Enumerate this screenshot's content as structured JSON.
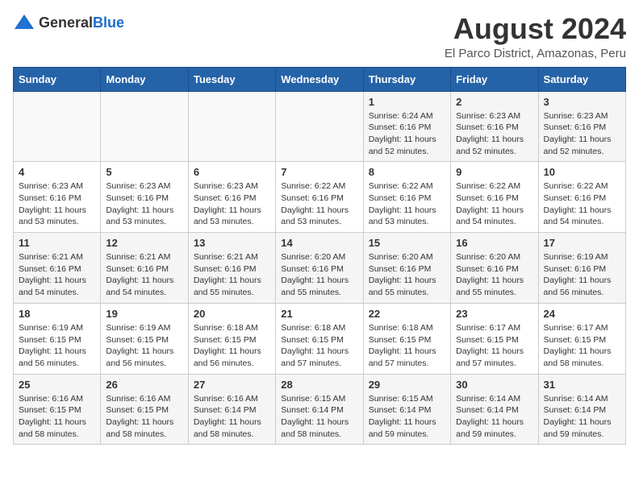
{
  "logo": {
    "general": "General",
    "blue": "Blue"
  },
  "title": "August 2024",
  "subtitle": "El Parco District, Amazonas, Peru",
  "days_of_week": [
    "Sunday",
    "Monday",
    "Tuesday",
    "Wednesday",
    "Thursday",
    "Friday",
    "Saturday"
  ],
  "weeks": [
    [
      {
        "day": "",
        "info": ""
      },
      {
        "day": "",
        "info": ""
      },
      {
        "day": "",
        "info": ""
      },
      {
        "day": "",
        "info": ""
      },
      {
        "day": "1",
        "info": "Sunrise: 6:24 AM\nSunset: 6:16 PM\nDaylight: 11 hours and 52 minutes."
      },
      {
        "day": "2",
        "info": "Sunrise: 6:23 AM\nSunset: 6:16 PM\nDaylight: 11 hours and 52 minutes."
      },
      {
        "day": "3",
        "info": "Sunrise: 6:23 AM\nSunset: 6:16 PM\nDaylight: 11 hours and 52 minutes."
      }
    ],
    [
      {
        "day": "4",
        "info": "Sunrise: 6:23 AM\nSunset: 6:16 PM\nDaylight: 11 hours and 53 minutes."
      },
      {
        "day": "5",
        "info": "Sunrise: 6:23 AM\nSunset: 6:16 PM\nDaylight: 11 hours and 53 minutes."
      },
      {
        "day": "6",
        "info": "Sunrise: 6:23 AM\nSunset: 6:16 PM\nDaylight: 11 hours and 53 minutes."
      },
      {
        "day": "7",
        "info": "Sunrise: 6:22 AM\nSunset: 6:16 PM\nDaylight: 11 hours and 53 minutes."
      },
      {
        "day": "8",
        "info": "Sunrise: 6:22 AM\nSunset: 6:16 PM\nDaylight: 11 hours and 53 minutes."
      },
      {
        "day": "9",
        "info": "Sunrise: 6:22 AM\nSunset: 6:16 PM\nDaylight: 11 hours and 54 minutes."
      },
      {
        "day": "10",
        "info": "Sunrise: 6:22 AM\nSunset: 6:16 PM\nDaylight: 11 hours and 54 minutes."
      }
    ],
    [
      {
        "day": "11",
        "info": "Sunrise: 6:21 AM\nSunset: 6:16 PM\nDaylight: 11 hours and 54 minutes."
      },
      {
        "day": "12",
        "info": "Sunrise: 6:21 AM\nSunset: 6:16 PM\nDaylight: 11 hours and 54 minutes."
      },
      {
        "day": "13",
        "info": "Sunrise: 6:21 AM\nSunset: 6:16 PM\nDaylight: 11 hours and 55 minutes."
      },
      {
        "day": "14",
        "info": "Sunrise: 6:20 AM\nSunset: 6:16 PM\nDaylight: 11 hours and 55 minutes."
      },
      {
        "day": "15",
        "info": "Sunrise: 6:20 AM\nSunset: 6:16 PM\nDaylight: 11 hours and 55 minutes."
      },
      {
        "day": "16",
        "info": "Sunrise: 6:20 AM\nSunset: 6:16 PM\nDaylight: 11 hours and 55 minutes."
      },
      {
        "day": "17",
        "info": "Sunrise: 6:19 AM\nSunset: 6:16 PM\nDaylight: 11 hours and 56 minutes."
      }
    ],
    [
      {
        "day": "18",
        "info": "Sunrise: 6:19 AM\nSunset: 6:15 PM\nDaylight: 11 hours and 56 minutes."
      },
      {
        "day": "19",
        "info": "Sunrise: 6:19 AM\nSunset: 6:15 PM\nDaylight: 11 hours and 56 minutes."
      },
      {
        "day": "20",
        "info": "Sunrise: 6:18 AM\nSunset: 6:15 PM\nDaylight: 11 hours and 56 minutes."
      },
      {
        "day": "21",
        "info": "Sunrise: 6:18 AM\nSunset: 6:15 PM\nDaylight: 11 hours and 57 minutes."
      },
      {
        "day": "22",
        "info": "Sunrise: 6:18 AM\nSunset: 6:15 PM\nDaylight: 11 hours and 57 minutes."
      },
      {
        "day": "23",
        "info": "Sunrise: 6:17 AM\nSunset: 6:15 PM\nDaylight: 11 hours and 57 minutes."
      },
      {
        "day": "24",
        "info": "Sunrise: 6:17 AM\nSunset: 6:15 PM\nDaylight: 11 hours and 58 minutes."
      }
    ],
    [
      {
        "day": "25",
        "info": "Sunrise: 6:16 AM\nSunset: 6:15 PM\nDaylight: 11 hours and 58 minutes."
      },
      {
        "day": "26",
        "info": "Sunrise: 6:16 AM\nSunset: 6:15 PM\nDaylight: 11 hours and 58 minutes."
      },
      {
        "day": "27",
        "info": "Sunrise: 6:16 AM\nSunset: 6:14 PM\nDaylight: 11 hours and 58 minutes."
      },
      {
        "day": "28",
        "info": "Sunrise: 6:15 AM\nSunset: 6:14 PM\nDaylight: 11 hours and 58 minutes."
      },
      {
        "day": "29",
        "info": "Sunrise: 6:15 AM\nSunset: 6:14 PM\nDaylight: 11 hours and 59 minutes."
      },
      {
        "day": "30",
        "info": "Sunrise: 6:14 AM\nSunset: 6:14 PM\nDaylight: 11 hours and 59 minutes."
      },
      {
        "day": "31",
        "info": "Sunrise: 6:14 AM\nSunset: 6:14 PM\nDaylight: 11 hours and 59 minutes."
      }
    ]
  ]
}
